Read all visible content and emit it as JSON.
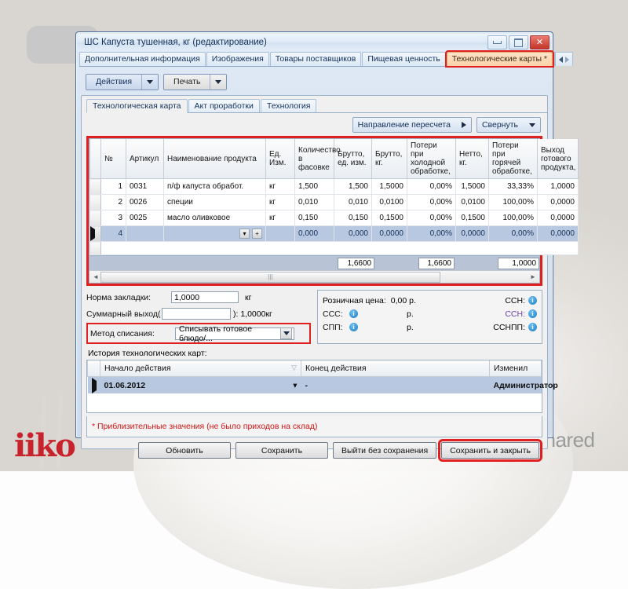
{
  "window": {
    "title": "ШС Капуста тушенная, кг (редактирование)",
    "minimize_label": "",
    "maximize_label": "",
    "close_label": "✕"
  },
  "top_tabs": [
    {
      "label": "Дополнительная информация",
      "active": false
    },
    {
      "label": "Изображения",
      "active": false
    },
    {
      "label": "Товары поставщиков",
      "active": false
    },
    {
      "label": "Пищевая ценность",
      "active": false
    },
    {
      "label": "Технологические карты *",
      "active": true,
      "highlighted": true
    }
  ],
  "toolbar": {
    "actions_label": "Действия",
    "print_label": "Печать"
  },
  "sub_tabs": [
    {
      "label": "Технологическая карта",
      "selected": true
    },
    {
      "label": "Акт проработки",
      "selected": false
    },
    {
      "label": "Технология",
      "selected": false
    }
  ],
  "upper_buttons": {
    "recalc_direction": "Направление пересчета",
    "collapse": "Свернуть"
  },
  "grid": {
    "headers": [
      "№",
      "Артикул",
      "Наименование продукта",
      "Ед. Изм.",
      "Количество в фасовке",
      "Брутто, ед. изм.",
      "Брутто, кг.",
      "Потери при холодной обработке,",
      "Нетто, кг.",
      "Потери при горячей обработке,",
      "Выход готового продукта,"
    ],
    "rows": [
      {
        "no": "1",
        "code": "0031",
        "name": "п/ф капуста обработ.",
        "unit": "кг",
        "pack": "1,500",
        "brutto_unit": "1,500",
        "brutto_kg": "1,5000",
        "cold_loss": "0,00%",
        "netto": "1,5000",
        "hot_loss": "33,33%",
        "yield": "1,0000"
      },
      {
        "no": "2",
        "code": "0026",
        "name": "специи",
        "unit": "кг",
        "pack": "0,010",
        "brutto_unit": "0,010",
        "brutto_kg": "0,0100",
        "cold_loss": "0,00%",
        "netto": "0,0100",
        "hot_loss": "100,00%",
        "yield": "0,0000"
      },
      {
        "no": "3",
        "code": "0025",
        "name": "масло оливковое",
        "unit": "кг",
        "pack": "0,150",
        "brutto_unit": "0,150",
        "brutto_kg": "0,1500",
        "cold_loss": "0,00%",
        "netto": "0,1500",
        "hot_loss": "100,00%",
        "yield": "0,0000"
      },
      {
        "no": "4",
        "code": "",
        "name": "",
        "unit": "",
        "pack": "0,000",
        "brutto_unit": "0,000",
        "brutto_kg": "0,0000",
        "cold_loss": "0,00%",
        "netto": "0,0000",
        "hot_loss": "0,00%",
        "yield": "0,0000"
      }
    ],
    "totals": {
      "brutto_kg": "1,6600",
      "netto": "1,6600",
      "yield": "1,0000"
    }
  },
  "form_left": {
    "norm_label": "Норма закладки:",
    "norm_value": "1,0000",
    "norm_unit": "кг",
    "total_out_label": "Суммарный выход(",
    "total_out_value": "",
    "total_out_suffix": "): 1,0000кг",
    "writeoff_label": "Метод списания:",
    "writeoff_value": "Списывать готовое блюдо/..."
  },
  "form_right": {
    "retail_label": "Розничная цена:",
    "retail_value": "0,00 р.",
    "ssn_label": "ССН:",
    "sss_label": "ССС:",
    "sss_currency": "р.",
    "ssn2_label": "ССН:",
    "spp_label": "СПП:",
    "spp_currency": "р.",
    "ssnpp_label": "ССНПП:"
  },
  "history": {
    "title": "История технологических карт:",
    "headers": [
      "Начало действия",
      "Конец действия",
      "Изменил"
    ],
    "rows": [
      {
        "start": "01.06.2012",
        "end": "-",
        "changed_by": "Администратор"
      }
    ]
  },
  "footnote": "* Приблизительные значения (не было приходов на склад)",
  "footer_buttons": [
    {
      "label": "Обновить",
      "highlighted": false
    },
    {
      "label": "Сохранить",
      "highlighted": false
    },
    {
      "label": "Выйти без сохранения",
      "highlighted": false
    },
    {
      "label": "Сохранить и закрыть",
      "highlighted": true
    }
  ],
  "branding": {
    "logo_text": "iiko",
    "watermark_text": "MyShared"
  },
  "colors": {
    "highlight_red": "#e02020",
    "active_tab_orange": "#fcd3a9",
    "selection_blue": "#b8c8e0",
    "note_red": "#d21515",
    "logo_red": "#c8232c"
  }
}
